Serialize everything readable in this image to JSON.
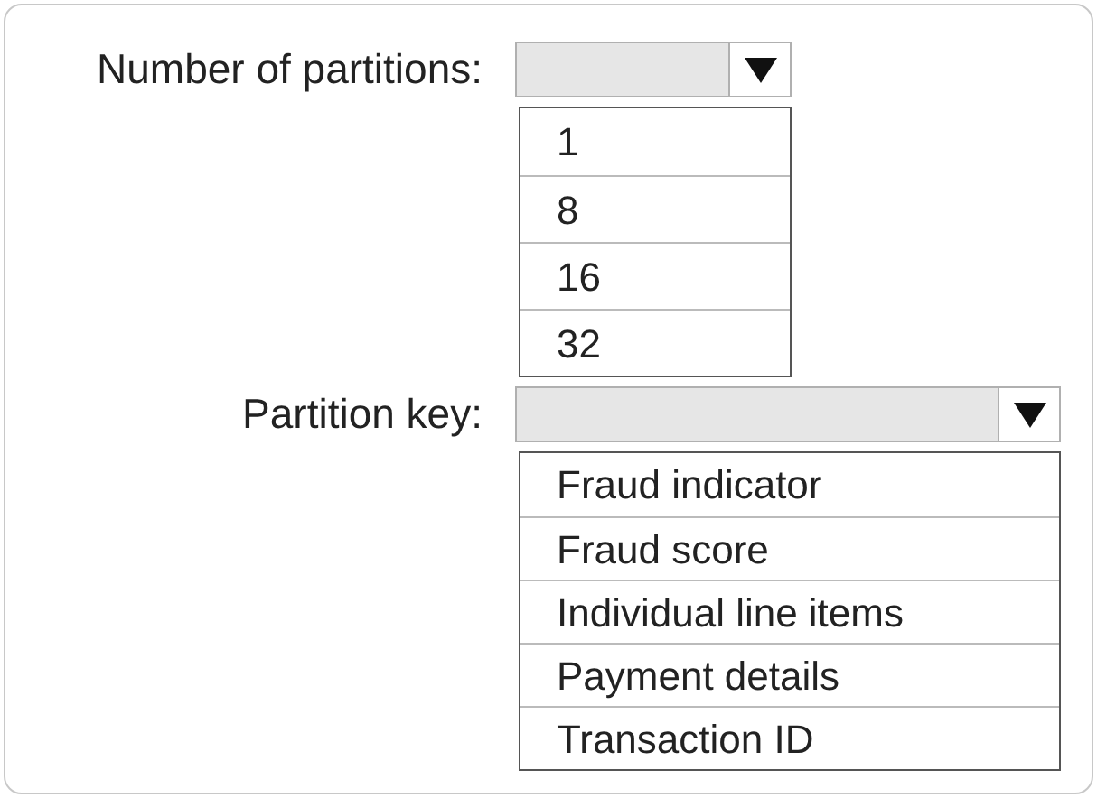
{
  "fields": [
    {
      "label": "Number of partitions:",
      "options": [
        "1",
        "8",
        "16",
        "32"
      ]
    },
    {
      "label": "Partition key:",
      "options": [
        "Fraud indicator",
        "Fraud score",
        "Individual line items",
        "Payment details",
        "Transaction ID"
      ]
    }
  ]
}
